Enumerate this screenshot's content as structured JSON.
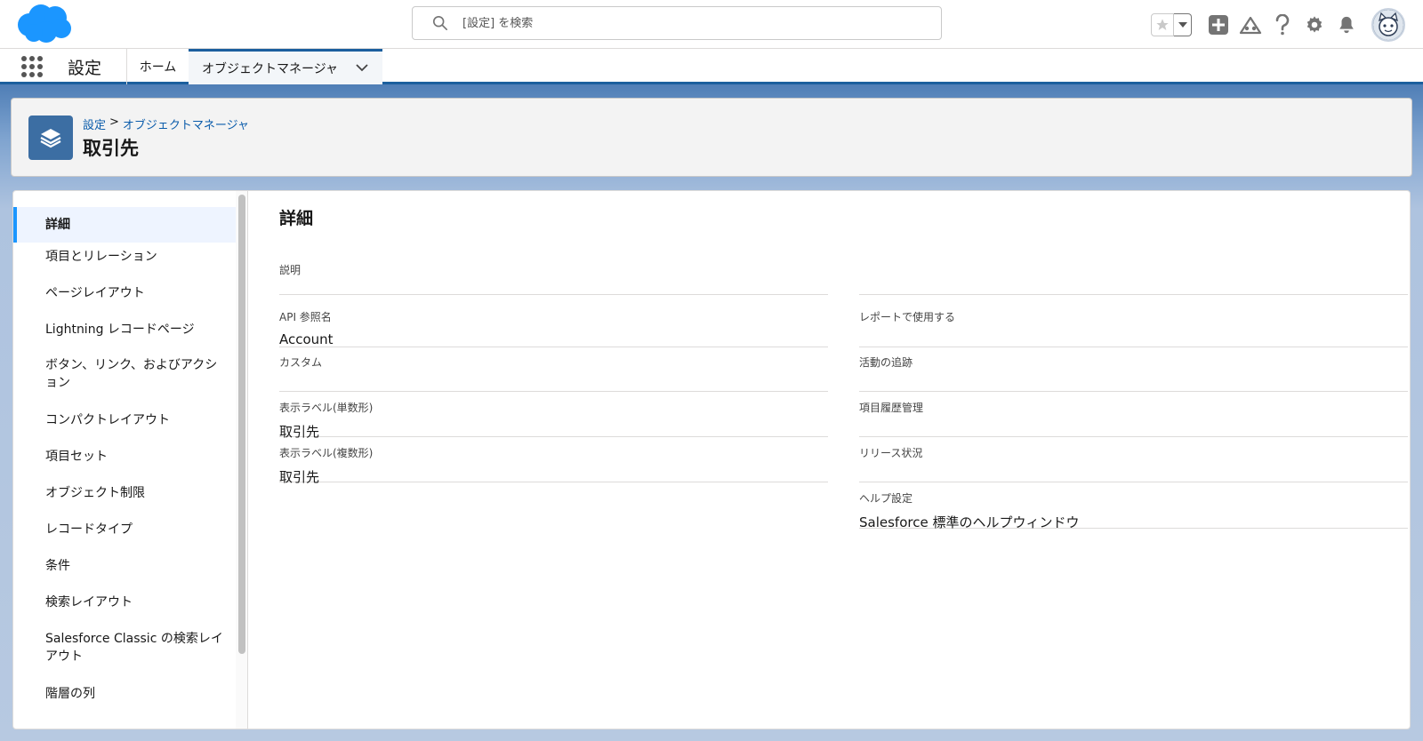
{
  "header": {
    "search_placeholder": "[設定] を検索",
    "colors": {
      "brand": "#1b96ff",
      "nav_accent": "#1b5f9e",
      "link": "#0b5cab"
    },
    "icons": [
      "salesforce-cloud-icon",
      "search-icon",
      "star-icon",
      "chevron-down-icon",
      "add-icon",
      "trailhead-icon",
      "help-icon",
      "gear-icon",
      "bell-icon",
      "avatar"
    ]
  },
  "context_bar": {
    "app_name": "設定",
    "tabs": [
      {
        "label": "ホーム"
      },
      {
        "label": "オブジェクトマネージャ"
      }
    ]
  },
  "page_header": {
    "breadcrumb": [
      "設定",
      ">",
      "オブジェクトマネージャ"
    ],
    "title": "取引先"
  },
  "side_nav": {
    "items": [
      {
        "label": "詳細",
        "active": true
      },
      {
        "label": "項目とリレーション"
      },
      {
        "label": "ページレイアウト"
      },
      {
        "label": "Lightning レコードページ"
      },
      {
        "label": "ボタン、リンク、およびアクション"
      },
      {
        "label": "コンパクトレイアウト"
      },
      {
        "label": "項目セット"
      },
      {
        "label": "オブジェクト制限"
      },
      {
        "label": "レコードタイプ"
      },
      {
        "label": "条件"
      },
      {
        "label": "検索レイアウト"
      },
      {
        "label": "Salesforce Classic の検索レイアウト"
      },
      {
        "label": "階層の列"
      }
    ]
  },
  "detail": {
    "title": "詳細",
    "description_label": "説明",
    "left_fields": [
      {
        "label": "API 参照名",
        "value": "Account"
      },
      {
        "label": "カスタム",
        "value": ""
      },
      {
        "label": "表示ラベル(単数形)",
        "value": "取引先"
      },
      {
        "label": "表示ラベル(複数形)",
        "value": "取引先"
      }
    ],
    "right_fields": [
      {
        "label": "レポートで使用する",
        "value": ""
      },
      {
        "label": "活動の追跡",
        "value": ""
      },
      {
        "label": "項目履歴管理",
        "value": ""
      },
      {
        "label": "リリース状況",
        "value": ""
      },
      {
        "label": "ヘルプ設定",
        "value": "Salesforce 標準のヘルプウィンドウ"
      }
    ]
  }
}
